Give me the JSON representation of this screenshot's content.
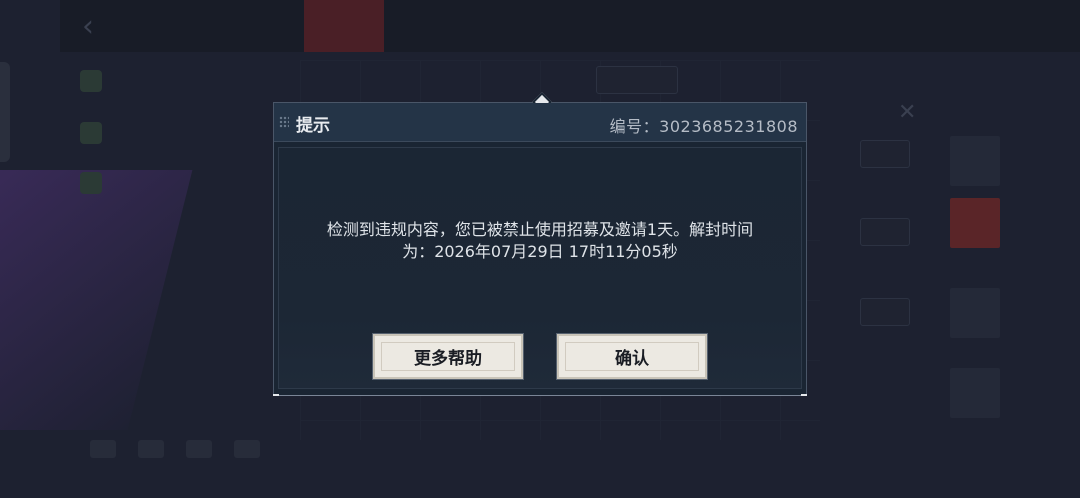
{
  "dialog": {
    "title": "提示",
    "id_text": "编号：3023685231808",
    "message_line1": "检测到违规内容，您已被禁止使用招募及邀请1天。解封时间",
    "message_line2": "为：2026年07月29日 17时11分05秒",
    "help_button": "更多帮助",
    "confirm_button": "确认"
  },
  "icons": {
    "back": "chevron-left-icon",
    "grip": "drag-grip-icon",
    "gem": "diamond-ornament-icon"
  },
  "colors": {
    "dialog_bg": "#1a2533",
    "header_bg": "#243447",
    "button_bg": "#ece9e2",
    "text": "#dfe3e8"
  }
}
